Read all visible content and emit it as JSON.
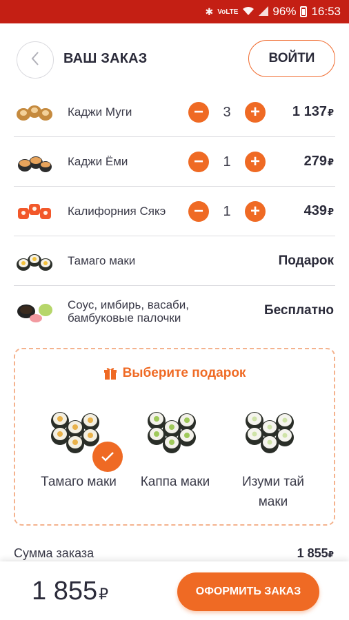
{
  "status_bar": {
    "network": "VoLTE",
    "battery": "96%",
    "time": "16:53"
  },
  "header": {
    "title": "ВАШ ЗАКАЗ",
    "login_label": "ВОЙТИ"
  },
  "currency": "₽",
  "order_items": [
    {
      "name": "Каджи Муги",
      "qty": "3",
      "price": "1 137",
      "icon": "sushi-roll-tempura-icon"
    },
    {
      "name": "Каджи Ёми",
      "qty": "1",
      "price": "279",
      "icon": "sushi-roll-baked-icon"
    },
    {
      "name": "Калифорния Сякэ",
      "qty": "1",
      "price": "439",
      "icon": "sushi-roll-salmon-icon"
    },
    {
      "name": "Тамаго маки",
      "status": "Подарок",
      "icon": "sushi-roll-tamago-icon"
    },
    {
      "name": "Соус, имбирь, васаби, бамбуковые палочки",
      "status": "Бесплатно",
      "icon": "sauce-ginger-wasabi-icon"
    }
  ],
  "gift": {
    "title": "Выберите подарок",
    "options": [
      {
        "label": "Тамаго маки",
        "selected": true
      },
      {
        "label": "Каппа маки",
        "selected": false
      },
      {
        "label": "Изуми тай маки",
        "selected": false
      }
    ]
  },
  "summary": {
    "label": "Сумма заказа",
    "value": "1 855"
  },
  "footer": {
    "total": "1 855",
    "checkout_label": "ОФОРМИТЬ ЗАКАЗ"
  },
  "colors": {
    "accent": "#ef6a24",
    "status_bar": "#c41f14",
    "text": "#2b2b3a"
  }
}
